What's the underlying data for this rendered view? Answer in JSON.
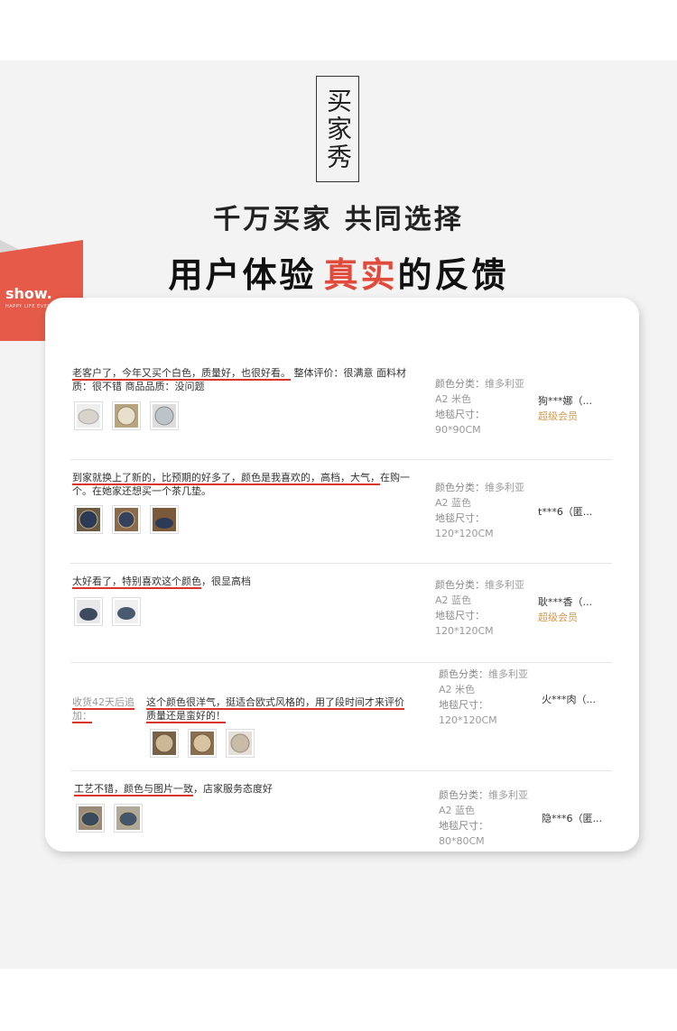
{
  "header": {
    "title": "买家秀",
    "subtitle": "千万买家 共同选择",
    "headline_prefix": "用户体验",
    "headline_accent": "真实",
    "headline_suffix": "的反馈",
    "ribbon_label": "show.",
    "ribbon_tag": "HAPPY LIFE EVERYDAY"
  },
  "colors": {
    "accent": "#e04b3b",
    "underline": "#d9352a",
    "member": "#d49a4a"
  },
  "labels": {
    "color_class": "颜色分类：",
    "rug_size": "地毯尺寸："
  },
  "reviews": [
    {
      "text_underlined": "老客户了，今年又买个白色，质量好，也很好看。",
      "text_rest": " 整体评价：很满意 面料材质：很不错 商品品质：没问题",
      "color_value": "维多利亚 A2 米色",
      "size_value": "90*90CM",
      "user": "狗***娜（...",
      "level": "超级会员",
      "thumb_tone": [
        "#d8d4cc",
        "#c9b896",
        "#bcc3c9"
      ]
    },
    {
      "text_underlined": "到家就换上了新的，比预期的好多了，颜色是我喜欢的，高档，大气，",
      "text_rest": "在购一个。在她家还想买一个茶几垫。",
      "color_value": "维多利亚 A2 蓝色",
      "size_value": "120*120CM",
      "user": "t***6（匿...",
      "level": "",
      "thumb_tone": [
        "#2c3a55",
        "#5b4a3a",
        "#6b5a44"
      ]
    },
    {
      "text_underlined": "太好看了，特别喜欢这个颜色",
      "text_rest": "，很显高档",
      "color_value": "维多利亚 A2 蓝色",
      "size_value": "120*120CM",
      "user": "耿***香（...",
      "level": "超级会员",
      "thumb_tone": [
        "#3e4a5e",
        "#4a5a70"
      ]
    },
    {
      "followup": "收货42天后追加：",
      "text_underlined": "这个颜色很洋气，挺适合欧式风格的，用了段时间才来评价质量还是蛮好的！",
      "text_rest": "",
      "color_value": "维多利亚 A2 米色",
      "size_value": "120*120CM",
      "user": "火***肉（...",
      "level": "",
      "thumb_tone": [
        "#a08a6e",
        "#b09878",
        "#c8bca8"
      ]
    },
    {
      "text_underlined": "工艺不错，颜色与图片一致",
      "text_rest": "，店家服务态度好",
      "color_value": "维多利亚 A2 蓝色",
      "size_value": "80*80CM",
      "user": "隐***6（匿...",
      "level": "",
      "thumb_tone": [
        "#394a5c",
        "#44566a"
      ]
    }
  ]
}
